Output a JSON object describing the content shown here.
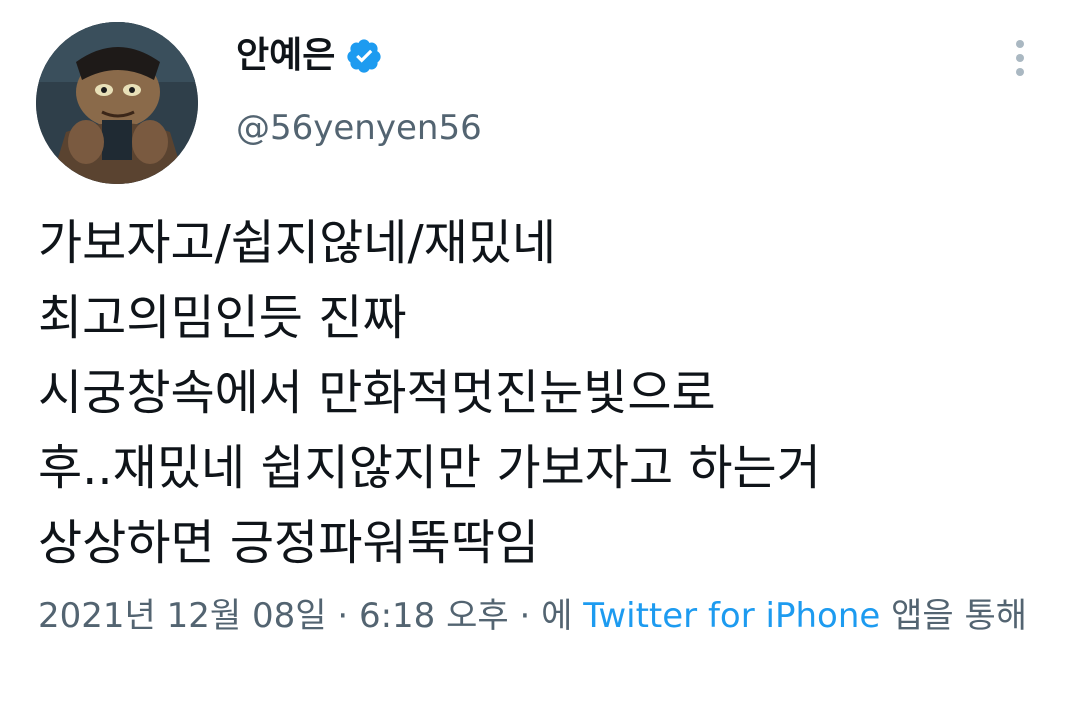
{
  "user": {
    "display_name": "안예은",
    "handle": "@56yenyen56",
    "verified": true,
    "verified_color": "#1d9bf0",
    "avatar_icon": "user-avatar-image"
  },
  "more_icon": "more-vertical-icon",
  "tweet": {
    "lines": [
      "가보자고/쉽지않네/재밌네",
      "최고의밈인듯 진짜",
      "시궁창속에서 만화적멋진눈빛으로",
      "후..재밌네 쉽지않지만 가보자고 하는거",
      "상상하면 긍정파워뚝딱임"
    ]
  },
  "meta": {
    "date": "2021년 12월 08일",
    "separator": " · ",
    "time": "6:18 오후",
    "prefix": "에 ",
    "source": "Twitter for iPhone",
    "suffix": " 앱을 통해"
  },
  "colors": {
    "text": "#0f1419",
    "muted": "#536471",
    "link": "#1d9bf0"
  }
}
